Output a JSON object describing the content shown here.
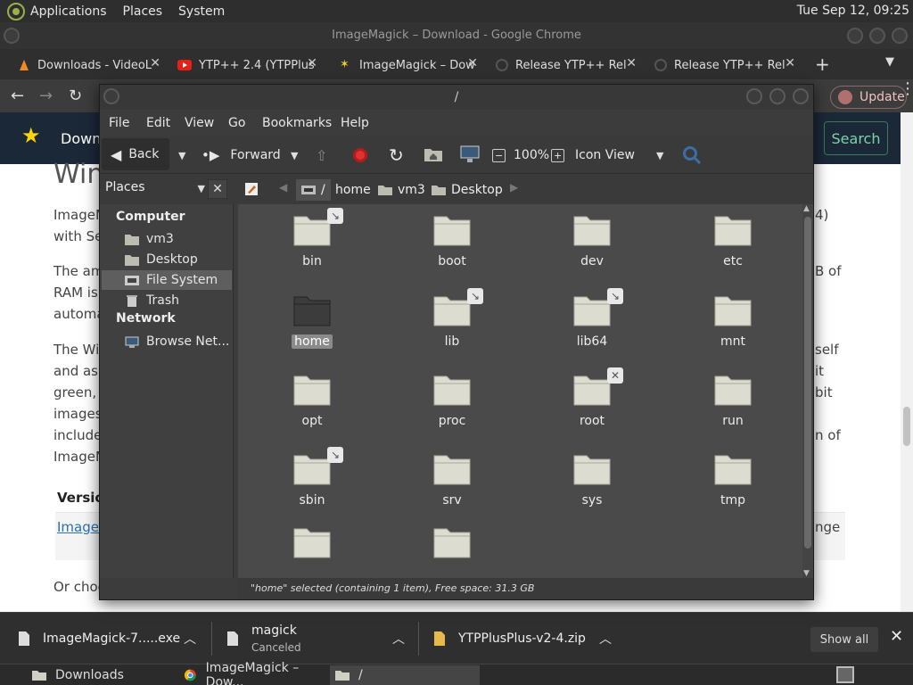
{
  "topbar": {
    "menus": [
      "Applications",
      "Places",
      "System"
    ],
    "clock": "Tue Sep 12, 09:25"
  },
  "chrome": {
    "title": "ImageMagick – Download - Google Chrome",
    "tabs": [
      {
        "label": "Downloads - VideoL",
        "icon": "vlc-cone-icon"
      },
      {
        "label": "YTP++ 2.4 (YTPPlus",
        "icon": "youtube-icon"
      },
      {
        "label": "ImageMagick – Dow",
        "icon": "imagemagick-icon"
      },
      {
        "label": "Release YTP++ Rel",
        "icon": "github-icon"
      },
      {
        "label": "Release YTP++ Rel",
        "icon": "github-icon"
      }
    ],
    "new_tab": "+",
    "update_label": "Update"
  },
  "page": {
    "header_title": "Down",
    "search_label": "Search",
    "heading": "Win",
    "lines": [
      "ImageM",
      "with Se",
      "The am",
      "RAM is",
      "automa",
      "The Wi",
      "and ask",
      "green,",
      "images",
      "include",
      "ImageM"
    ],
    "right_lines": [
      "4)",
      "B of",
      "self",
      "it",
      "bit",
      "n of"
    ],
    "version_label": "Versio",
    "version_link": "Image",
    "version_right": "nge",
    "footer_line": "Or choo"
  },
  "downloads": [
    {
      "name": "ImageMagick-7.....exe",
      "status": ""
    },
    {
      "name": "magick",
      "status": "Canceled"
    },
    {
      "name": "YTPPlusPlus-v2-4.zip",
      "status": ""
    }
  ],
  "show_all": "Show all",
  "taskbar": [
    {
      "label": "Downloads",
      "icon": "folder-icon"
    },
    {
      "label": "ImageMagick – Dow...",
      "icon": "chrome-icon"
    },
    {
      "label": "/",
      "icon": "folder-icon"
    }
  ],
  "fm": {
    "title": "/",
    "menus": [
      "File",
      "Edit",
      "View",
      "Go",
      "Bookmarks",
      "Help"
    ],
    "toolbar": {
      "back": "Back",
      "forward": "Forward",
      "zoom": "100%",
      "view_mode": "Icon View"
    },
    "sidebar_selector": "Places",
    "breadcrumbs": [
      "/",
      "home",
      "vm3",
      "Desktop"
    ],
    "sidebar": {
      "computer_heading": "Computer",
      "computer_items": [
        "vm3",
        "Desktop",
        "File System",
        "Trash"
      ],
      "network_heading": "Network",
      "network_items": [
        "Browse Net..."
      ]
    },
    "folders": [
      {
        "name": "bin",
        "emblem": "symlink"
      },
      {
        "name": "boot",
        "emblem": ""
      },
      {
        "name": "dev",
        "emblem": ""
      },
      {
        "name": "etc",
        "emblem": ""
      },
      {
        "name": "home",
        "emblem": "",
        "selected": true
      },
      {
        "name": "lib",
        "emblem": "symlink"
      },
      {
        "name": "lib64",
        "emblem": "symlink"
      },
      {
        "name": "mnt",
        "emblem": ""
      },
      {
        "name": "opt",
        "emblem": ""
      },
      {
        "name": "proc",
        "emblem": ""
      },
      {
        "name": "root",
        "emblem": "locked"
      },
      {
        "name": "run",
        "emblem": ""
      },
      {
        "name": "sbin",
        "emblem": "symlink"
      },
      {
        "name": "srv",
        "emblem": ""
      },
      {
        "name": "sys",
        "emblem": ""
      },
      {
        "name": "tmp",
        "emblem": ""
      },
      {
        "name": "",
        "emblem": ""
      },
      {
        "name": "",
        "emblem": ""
      }
    ],
    "status": "\"home\" selected (containing 1 item), Free space: 31.3 GB"
  },
  "colors": {
    "folder_fill": "#dcdcd0",
    "folder_selected": "#3c3c3c",
    "accent_search": "#7fd1a8"
  }
}
